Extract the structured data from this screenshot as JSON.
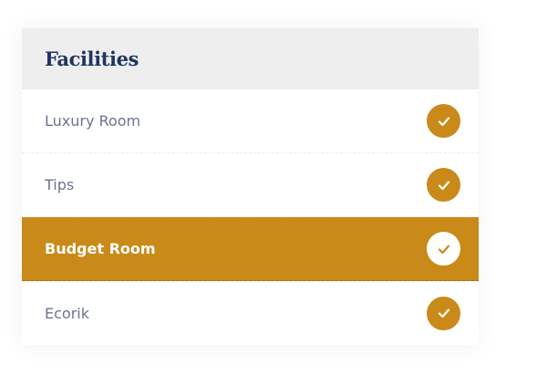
{
  "widget": {
    "title": "Facilities"
  },
  "facilities": [
    {
      "label": "Luxury Room",
      "icon": "check-icon",
      "active": false
    },
    {
      "label": "Tips",
      "icon": "check-icon",
      "active": false
    },
    {
      "label": "Budget Room",
      "icon": "check-icon",
      "active": true
    },
    {
      "label": "Ecorik",
      "icon": "check-icon",
      "active": false
    }
  ],
  "colors": {
    "accent": "#c98a19",
    "title": "#1f3560",
    "item_text": "#6b7590",
    "header_bg": "#eeeeee"
  }
}
